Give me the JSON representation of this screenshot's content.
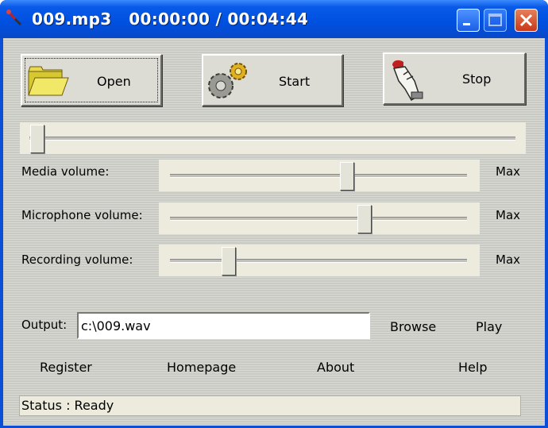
{
  "window": {
    "title": "009.mp3   00:00:00 / 00:04:44",
    "icons": {
      "app": "microphone-icon",
      "minimize": "minimize-icon",
      "maximize": "maximize-icon",
      "close": "close-icon"
    }
  },
  "toolbar": {
    "open_label": "Open",
    "start_label": "Start",
    "stop_label": "Stop",
    "open_icon": "folder-icon",
    "start_icon": "gears-icon",
    "stop_icon": "hand-icon"
  },
  "seek": {
    "position": 0.0
  },
  "volumes": [
    {
      "label": "Media volume:",
      "max_label": "Max",
      "level": 0.6
    },
    {
      "label": "Microphone volume:",
      "max_label": "Max",
      "level": 0.66
    },
    {
      "label": "Recording volume:",
      "max_label": "Max",
      "level": 0.2
    }
  ],
  "output": {
    "label": "Output:",
    "value": "c:\\009.wav",
    "browse_label": "Browse",
    "play_label": "Play"
  },
  "links": {
    "register": "Register",
    "homepage": "Homepage",
    "about": "About",
    "help": "Help"
  },
  "status": {
    "text": "Status : Ready"
  },
  "colors": {
    "titlebar": "#0a5ae8",
    "close": "#c8381a",
    "panel": "#d2d2cc",
    "track_bg": "#ecebdd"
  }
}
